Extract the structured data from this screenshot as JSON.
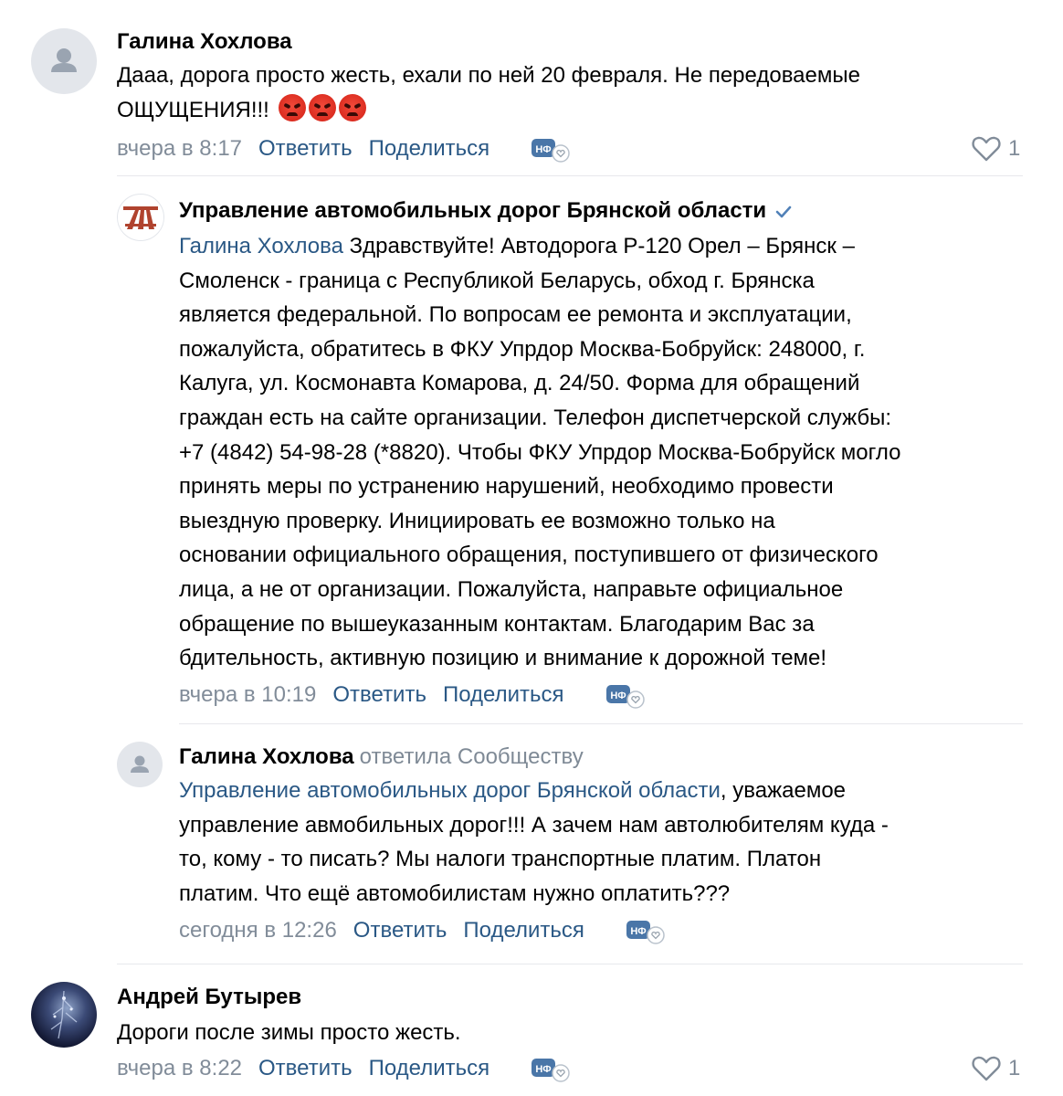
{
  "comments": [
    {
      "author": "Галина Хохлова",
      "text_lines": [
        "Дааа, дорога просто жесть, ехали по ней 20 февраля. Не передоваемые",
        "ОЩУЩЕНИЯ!!!"
      ],
      "emoji": [
        "angry-face",
        "angry-face",
        "angry-face"
      ],
      "date": "вчера в 8:17",
      "reply_label": "Ответить",
      "share_label": "Поделиться",
      "likes": "1"
    },
    {
      "author": "Управление автомобильных дорог Брянской области",
      "mention": "Галина Хохлова",
      "text_lines": [
        " Здравствуйте! Автодорога Р-120 Орел – Брянск –",
        "Смоленск - граница с Республикой Беларусь, обход г. Брянска",
        "является федеральной. По вопросам ее ремонта и эксплуатации,",
        "пожалуйста, обратитесь в ФКУ Упрдор Москва-Бобруйск: 248000, г.",
        "Калуга, ул. Космонавта Комарова, д. 24/50. Форма для обращений",
        "граждан есть на сайте организации. Телефон диспетчерской службы:",
        "+7 (4842) 54-98-28 (*8820). Чтобы ФКУ Упрдор Москва-Бобруйск могло",
        "принять меры по устранению нарушений, необходимо провести",
        "выездную проверку. Инициировать ее возможно только на",
        "основании официального обращения, поступившего от физического",
        "лица, а не от организации. Пожалуйста, направьте официальное",
        "обращение по вышеуказанным контактам. Благодарим Вас за",
        "бдительность, активную позицию и внимание к дорожной теме!"
      ],
      "date": "вчера в 10:19",
      "reply_label": "Ответить",
      "share_label": "Поделиться"
    },
    {
      "author": "Галина Хохлова",
      "replied_to": "ответила Сообществу",
      "mention": "Управление автомобильных дорог Брянской области",
      "text_lines": [
        ", уважаемое",
        "управление авмобильных дорог!!! А зачем нам автолюбителям куда -",
        "то, кому - то писать? Мы налоги транспортные платим. Платон",
        "платим. Что ещё автомобилистам нужно оплатить???"
      ],
      "date": "сегодня в 12:26",
      "reply_label": "Ответить",
      "share_label": "Поделиться"
    },
    {
      "author": "Андрей Бутырев",
      "text_lines": [
        "Дороги после зимы просто жесть."
      ],
      "date": "вчера в 8:22",
      "reply_label": "Ответить",
      "share_label": "Поделиться",
      "likes": "1"
    }
  ],
  "icons": {
    "verified": "checkmark-icon",
    "like": "heart-icon",
    "news": "nf-reaction-icon"
  },
  "colors": {
    "link": "#2a5885",
    "meta": "#818c99",
    "divider": "#e7e8ec",
    "verified": "#5181b8"
  }
}
